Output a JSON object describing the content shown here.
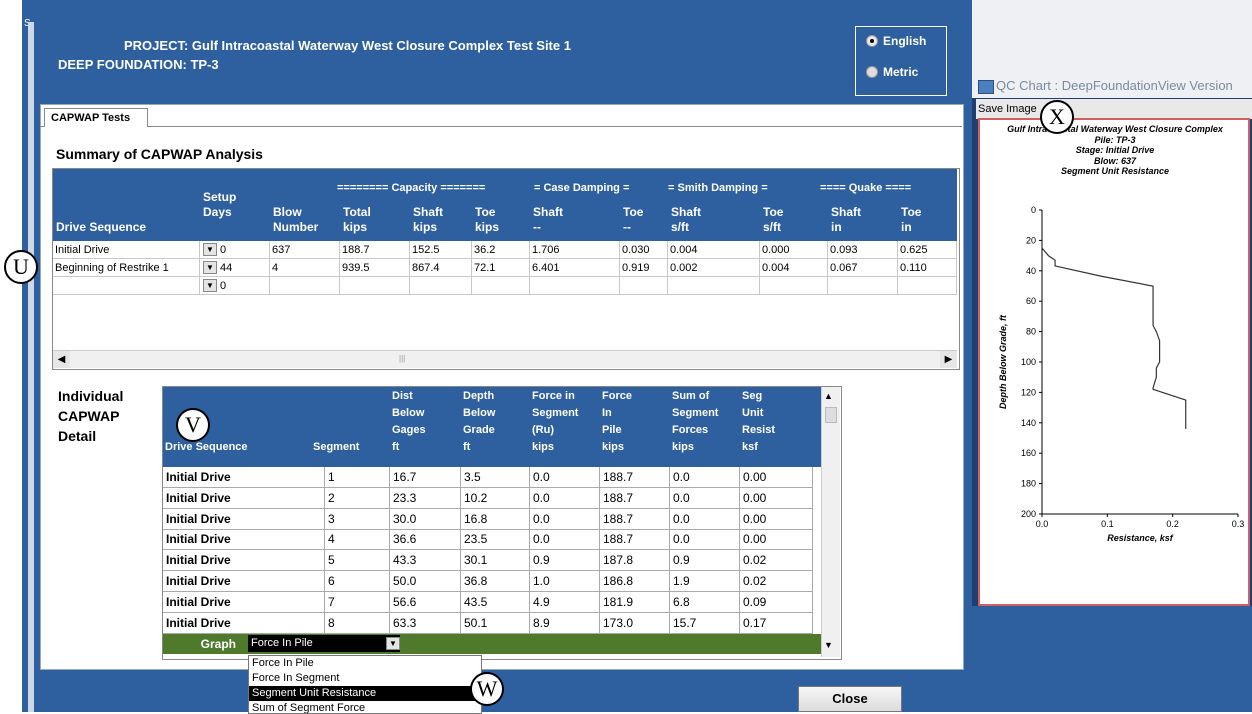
{
  "header": {
    "project_label": "PROJECT:",
    "project_value": "Gulf Intracoastal Waterway West Closure Complex Test Site 1",
    "foundation_label": "DEEP FOUNDATION:",
    "foundation_value": "TP-3",
    "units": {
      "english": "English",
      "metric": "Metric",
      "selected": "English"
    }
  },
  "tab": {
    "label": "CAPWAP Tests"
  },
  "summary": {
    "title": "Summary of CAPWAP Analysis",
    "groups": {
      "capacity": "======== Capacity =======",
      "case": "= Case Damping =",
      "smith": "= Smith Damping =",
      "quake": "==== Quake ===="
    },
    "columns": [
      {
        "l1": "",
        "l2": "",
        "l3": "Drive Sequence"
      },
      {
        "l1": "Setup",
        "l2": "Days",
        "l3": ""
      },
      {
        "l1": "",
        "l2": "Blow",
        "l3": "Number"
      },
      {
        "l1": "",
        "l2": "Total",
        "l3": "kips"
      },
      {
        "l1": "",
        "l2": "Shaft",
        "l3": "kips"
      },
      {
        "l1": "",
        "l2": "Toe",
        "l3": "kips"
      },
      {
        "l1": "",
        "l2": "Shaft",
        "l3": "--"
      },
      {
        "l1": "",
        "l2": "Toe",
        "l3": "--"
      },
      {
        "l1": "",
        "l2": "Shaft",
        "l3": "s/ft"
      },
      {
        "l1": "",
        "l2": "Toe",
        "l3": "s/ft"
      },
      {
        "l1": "",
        "l2": "Shaft",
        "l3": "in"
      },
      {
        "l1": "",
        "l2": "Toe",
        "l3": "in"
      }
    ],
    "rows": [
      [
        "Initial Drive",
        "0",
        "637",
        "188.7",
        "152.5",
        "36.2",
        "1.706",
        "0.030",
        "0.004",
        "0.000",
        "0.093",
        "0.625"
      ],
      [
        "Beginning of Restrike 1",
        "44",
        "4",
        "939.5",
        "867.4",
        "72.1",
        "6.401",
        "0.919",
        "0.002",
        "0.004",
        "0.067",
        "0.110"
      ],
      [
        "",
        "0",
        "",
        "",
        "",
        "",
        "",
        "",
        "",
        "",
        "",
        ""
      ]
    ],
    "scroll_grip": "|||"
  },
  "detail": {
    "title_lines": [
      "Individual",
      "CAPWAP",
      "Detail"
    ],
    "columns": [
      {
        "l1": "",
        "l2": "",
        "l3": "",
        "l4": "Drive Sequence"
      },
      {
        "l1": "",
        "l2": "",
        "l3": "",
        "l4": "Segment"
      },
      {
        "l1": "Dist",
        "l2": "Below",
        "l3": "Gages",
        "l4": "ft"
      },
      {
        "l1": "Depth",
        "l2": "Below",
        "l3": "Grade",
        "l4": "ft"
      },
      {
        "l1": "Force in",
        "l2": "Segment",
        "l3": "(Ru)",
        "l4": "kips"
      },
      {
        "l1": "Force",
        "l2": "In",
        "l3": "Pile",
        "l4": "kips"
      },
      {
        "l1": "Sum of",
        "l2": "Segment",
        "l3": "Forces",
        "l4": "kips"
      },
      {
        "l1": "Seg",
        "l2": "Unit",
        "l3": "Resist",
        "l4": "ksf"
      }
    ],
    "rows": [
      [
        "Initial Drive",
        "1",
        "16.7",
        "3.5",
        "0.0",
        "188.7",
        "0.0",
        "0.00"
      ],
      [
        "Initial Drive",
        "2",
        "23.3",
        "10.2",
        "0.0",
        "188.7",
        "0.0",
        "0.00"
      ],
      [
        "Initial Drive",
        "3",
        "30.0",
        "16.8",
        "0.0",
        "188.7",
        "0.0",
        "0.00"
      ],
      [
        "Initial Drive",
        "4",
        "36.6",
        "23.5",
        "0.0",
        "188.7",
        "0.0",
        "0.00"
      ],
      [
        "Initial Drive",
        "5",
        "43.3",
        "30.1",
        "0.9",
        "187.8",
        "0.9",
        "0.02"
      ],
      [
        "Initial Drive",
        "6",
        "50.0",
        "36.8",
        "1.0",
        "186.8",
        "1.9",
        "0.02"
      ],
      [
        "Initial Drive",
        "7",
        "56.6",
        "43.5",
        "4.9",
        "181.9",
        "6.8",
        "0.09"
      ],
      [
        "Initial Drive",
        "8",
        "63.3",
        "50.1",
        "8.9",
        "173.0",
        "15.7",
        "0.17"
      ]
    ],
    "graph_label": "Graph",
    "graph_selected": "Force In Pile",
    "graph_options": [
      "Force In Pile",
      "Force In Segment",
      "Segment Unit Resistance",
      "Sum of Segment Force"
    ],
    "graph_highlighted": "Segment Unit Resistance"
  },
  "close_label": "Close",
  "qc_window": {
    "title": "QC Chart : DeepFoundationView Version",
    "save_label": "Save Image",
    "chart_title_lines": [
      "Gulf Intracoastal Waterway West Closure Complex",
      "Pile: TP-3",
      "Stage: Initial Drive",
      "Blow: 637",
      "Segment Unit Resistance"
    ]
  },
  "chart_data": {
    "type": "line",
    "title": "Segment Unit Resistance",
    "xlabel": "Resistance, ksf",
    "ylabel": "Depth Below Grade, ft",
    "xlim": [
      0,
      0.3
    ],
    "ylim": [
      200,
      0
    ],
    "x_ticks": [
      "0.0",
      "0.1",
      "0.2",
      "0.3"
    ],
    "y_ticks": [
      "0",
      "20",
      "40",
      "60",
      "80",
      "100",
      "120",
      "140",
      "160",
      "180",
      "200"
    ],
    "series": [
      {
        "x": [
          0.0,
          0.0,
          0.01,
          0.02,
          0.02,
          0.09,
          0.17,
          0.17,
          0.17,
          0.175,
          0.18,
          0.18,
          0.175,
          0.175,
          0.17,
          0.17,
          0.22,
          0.22
        ],
        "y": [
          23.5,
          25,
          30.1,
          33,
          36.8,
          43.5,
          50.1,
          60,
          76,
          80,
          86,
          100,
          104,
          110,
          117,
          118,
          125,
          144
        ]
      }
    ]
  },
  "callouts": {
    "u": "U",
    "v": "V",
    "w": "W",
    "x": "X"
  },
  "corner_letter": "S"
}
